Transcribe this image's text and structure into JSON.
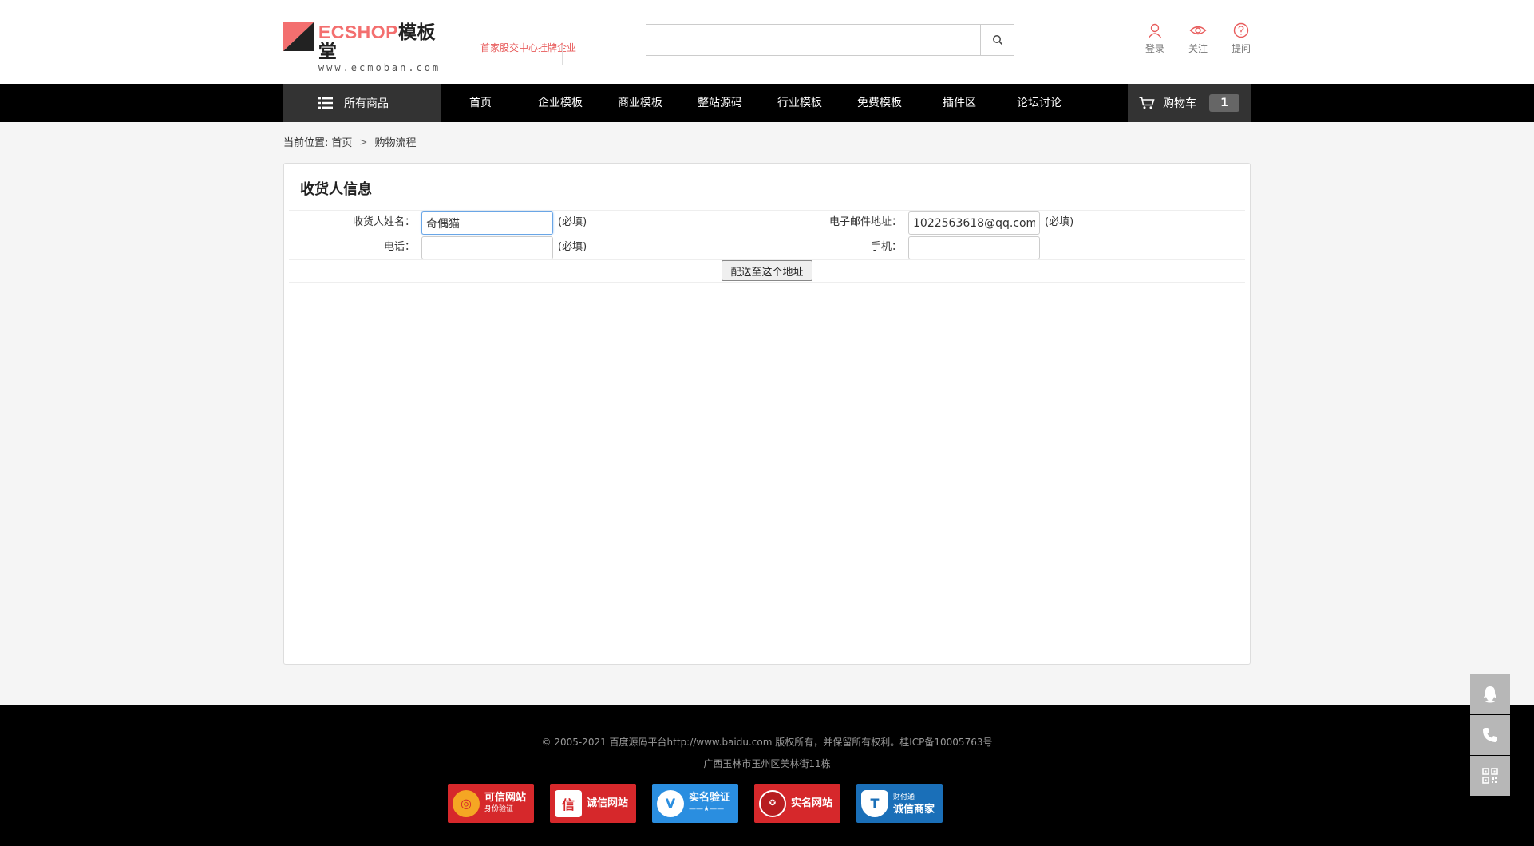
{
  "header": {
    "logo": {
      "brand_en": "ECSHOP",
      "brand_cn": "模板堂",
      "url": "www.ecmoban.com"
    },
    "banner_text": "首家股交中心挂牌企业",
    "search": {
      "value": "",
      "placeholder": ""
    },
    "links": [
      {
        "label": "登录",
        "icon": "user-icon"
      },
      {
        "label": "关注",
        "icon": "eye-icon"
      },
      {
        "label": "提问",
        "icon": "question-icon"
      }
    ]
  },
  "nav": {
    "all_label": "所有商品",
    "items": [
      "首页",
      "企业模板",
      "商业模板",
      "整站源码",
      "行业模板",
      "免费模板",
      "插件区",
      "论坛讨论"
    ],
    "cart_label": "购物车",
    "cart_count": "1"
  },
  "breadcrumb": {
    "prefix": "当前位置:",
    "home": "首页",
    "current": "购物流程"
  },
  "consignee": {
    "title": "收货人信息",
    "name_label": "收货人姓名：",
    "name_value": "奇偶猫",
    "email_label": "电子邮件地址：",
    "email_value": "1022563618@qq.com",
    "phone_label": "电话：",
    "phone_value": "",
    "mobile_label": "手机：",
    "mobile_value": "",
    "required": "(必填)",
    "submit_label": "配送至这个地址"
  },
  "footer": {
    "copyright": "© 2005-2021 百度源码平台http://www.baidu.com 版权所有，并保留所有权利。桂ICP备10005763号",
    "address": "广西玉林市玉州区美林街11栋",
    "badges": [
      {
        "title": "可信网站",
        "sub": "身份验证",
        "color": "#d6282b"
      },
      {
        "title": "诚信网站",
        "sub": "",
        "color": "#d6282b"
      },
      {
        "title": "实名验证",
        "sub": "——★——",
        "color": "#2a8ee0"
      },
      {
        "title": "实名网站",
        "sub": "",
        "color": "#d6282b"
      },
      {
        "title": "诚信商家",
        "sub": "财付通",
        "color": "#1a6fb8"
      }
    ]
  },
  "float": [
    "qq-icon",
    "phone-icon",
    "qrcode-icon"
  ]
}
